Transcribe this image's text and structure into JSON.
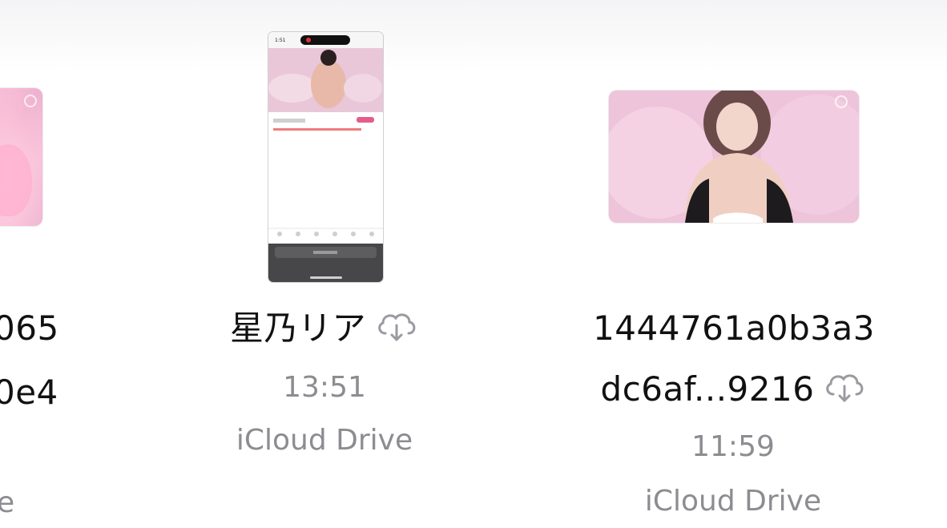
{
  "files": [
    {
      "name_line1": "065",
      "name_line2": "0e4",
      "location": "e",
      "thumbnail": "video-thumbnail-pink"
    },
    {
      "name_line1": "星乃リア",
      "time": "13:51",
      "location": "iCloud Drive",
      "thumbnail": "phone-screenshot-thumbnail",
      "download_icon": "cloud-download-icon"
    },
    {
      "name_line1": "1444761a0b3a3",
      "name_line2": "dc6af...9216",
      "time": "11:59",
      "location": "iCloud Drive",
      "thumbnail": "video-thumbnail-pink",
      "download_icon": "cloud-download-icon"
    }
  ],
  "colors": {
    "filename_text": "#111111",
    "secondary_text": "#8c8c91",
    "thumbnail_pink": "#f0c0d8"
  }
}
